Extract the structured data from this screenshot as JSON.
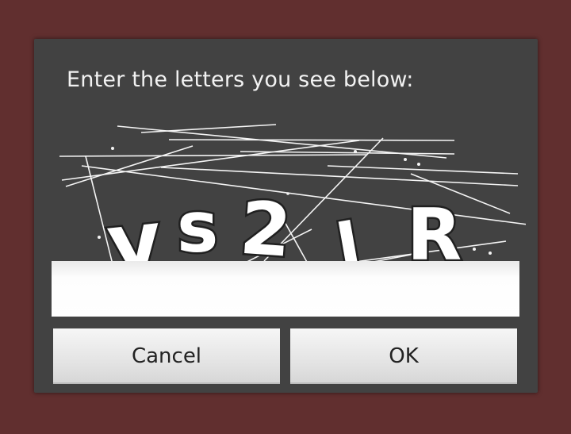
{
  "dialog": {
    "prompt": "Enter the letters you see below:",
    "captcha_text": "ys2lR",
    "input_value": "",
    "cancel_label": "Cancel",
    "ok_label": "OK"
  },
  "colors": {
    "backdrop": "#612f2f",
    "dialog": "#424242",
    "text": "#f2f2f2"
  }
}
